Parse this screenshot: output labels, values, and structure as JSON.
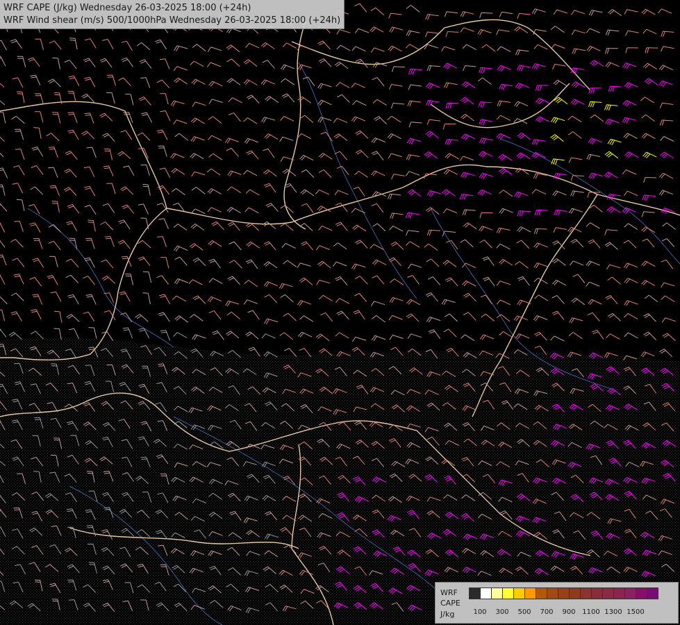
{
  "header": {
    "line1": "WRF CAPE (J/kg) Wednesday 26-03-2025 18:00 (+24h)",
    "line2": "WRF Wind shear (m/s) 500/1000hPa Wednesday 26-03-2025 18:00 (+24h)"
  },
  "legend": {
    "words": [
      "WRF",
      "CAPE",
      "J/kg"
    ],
    "colors": [
      "#2a2a2a",
      "#ffffff",
      "#ffff99",
      "#ffff33",
      "#ffcc00",
      "#ff9900",
      "#b35900",
      "#a34a10",
      "#9a4016",
      "#8f3a1c",
      "#8a3330",
      "#8a2d3a",
      "#8a2a44",
      "#8b254f",
      "#8a2160",
      "#870f6a",
      "#7a0a78"
    ],
    "tick_labels": [
      "100",
      "300",
      "500",
      "700",
      "900",
      "1100",
      "1300",
      "1500"
    ]
  },
  "palette": {
    "background": "#000000",
    "border": "#e8c9a0",
    "river": "#3d5e9e",
    "barb_salmon": "#e0827a",
    "barb_pink": "#c89a9a",
    "barb_grey": "#9a9a9a",
    "barb_magenta": "#ff00ff",
    "barb_yellow": "#ffff00"
  }
}
